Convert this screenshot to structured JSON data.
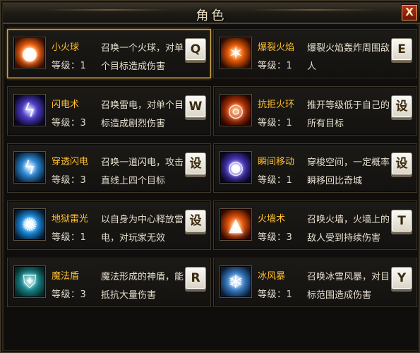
{
  "window": {
    "title": "角色",
    "close_label": "X"
  },
  "skills": [
    {
      "name": "小火球",
      "level": "等级：1",
      "desc": [
        "召唤一个火球，对单",
        "个目标造成伤害"
      ],
      "key": "Q",
      "icon": "fireball-icon",
      "colors": [
        "#3a0e02",
        "#ff6a12",
        "#ffd36a"
      ],
      "glyph": "●",
      "selected": true
    },
    {
      "name": "爆裂火焰",
      "level": "等级：1",
      "desc": [
        "爆裂火焰轰炸周围敌",
        "人"
      ],
      "key": "E",
      "icon": "explosive-flame-icon",
      "colors": [
        "#2e0b00",
        "#e85a06",
        "#ffd07a"
      ],
      "glyph": "✶",
      "selected": false
    },
    {
      "name": "闪电术",
      "level": "等级：3",
      "desc": [
        "召唤雷电，对单个目",
        "标造成剧烈伤害"
      ],
      "key": "W",
      "icon": "lightning-icon",
      "colors": [
        "#0a0624",
        "#4d3cc8",
        "#cfd6ff"
      ],
      "glyph": "ϟ",
      "selected": false
    },
    {
      "name": "抗拒火环",
      "level": "等级：1",
      "desc": [
        "推开等级低于自己的",
        "所有目标"
      ],
      "key": "设",
      "icon": "repel-fire-ring-icon",
      "colors": [
        "#2a0600",
        "#c83a08",
        "#ffb25a"
      ],
      "glyph": "◎",
      "selected": false
    },
    {
      "name": "穿透闪电",
      "level": "等级：3",
      "desc": [
        "召唤一道闪电，攻击",
        "直线上四个目标"
      ],
      "key": "设",
      "icon": "penetrating-lightning-icon",
      "colors": [
        "#061a2c",
        "#2e8ad8",
        "#e8f6ff"
      ],
      "glyph": "ϟ",
      "selected": false
    },
    {
      "name": "瞬间移动",
      "level": "等级：1",
      "desc": [
        "穿梭空间，一定概率",
        "瞬移回比奇城"
      ],
      "key": "设",
      "icon": "teleport-icon",
      "colors": [
        "#0a0628",
        "#4a38c0",
        "#bcb6ff"
      ],
      "glyph": "◉",
      "selected": false
    },
    {
      "name": "地狱雷光",
      "level": "等级：1",
      "desc": [
        "以自身为中心释放雷",
        "电，对玩家无效"
      ],
      "key": "设",
      "icon": "hell-thunder-icon",
      "colors": [
        "#041c30",
        "#1e90e8",
        "#e6f7ff"
      ],
      "glyph": "✺",
      "selected": false
    },
    {
      "name": "火墙术",
      "level": "等级：3",
      "desc": [
        "召唤火墙，火墙上的",
        "敌人受到持续伤害"
      ],
      "key": "T",
      "icon": "fire-wall-icon",
      "colors": [
        "#300800",
        "#e0520a",
        "#ffc26a"
      ],
      "glyph": "▲",
      "selected": false
    },
    {
      "name": "魔法盾",
      "level": "等级：3",
      "desc": [
        "魔法形成的神盾，能",
        "抵抗大量伤害"
      ],
      "key": "R",
      "icon": "magic-shield-icon",
      "colors": [
        "#042a26",
        "#1a8a92",
        "#9af0e6"
      ],
      "glyph": "⛨",
      "selected": false
    },
    {
      "name": "冰风暴",
      "level": "等级：1",
      "desc": [
        "召唤冰雪风暴，对目",
        "标范围造成伤害"
      ],
      "key": "Y",
      "icon": "ice-storm-icon",
      "colors": [
        "#081c36",
        "#3e86d0",
        "#e2f2ff"
      ],
      "glyph": "❄",
      "selected": false
    }
  ]
}
